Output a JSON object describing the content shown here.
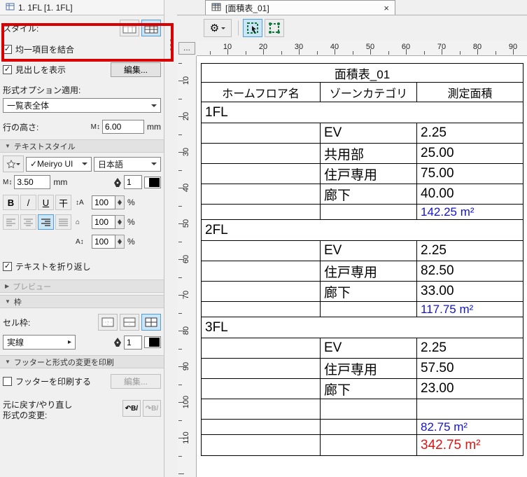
{
  "icons": {
    "check": "✓",
    "close": "×",
    "ellipsis": "...",
    "gear": "⚙",
    "tri_down": "▼",
    "tri_right": "▶",
    "flyout": "▸",
    "text_height": "M↕",
    "format_buttons": [
      "B",
      "/",
      "U",
      "干"
    ],
    "spacing_icons": [
      "↕A",
      "⌂",
      "A↕"
    ],
    "undo_format": "↶B/",
    "redo_format": "↷B/"
  },
  "colors": {
    "annotation_red": "#d80000",
    "sum_text_blue": "#1414cc",
    "total_text_red": "#e01414",
    "selected_button_blue": "#cde6f7",
    "marquee_green": "#0c7a3c"
  },
  "sidebar": {
    "tab_label": "1. 1FL [1. 1FL]",
    "style_label": "スタイル:",
    "merge_uniform_label": "均一項目を結合",
    "show_heading_label": "見出しを表示",
    "edit_button": "編集...",
    "apply_format_label": "形式オプション適用:",
    "scheme_scope_value": "一覧表全体",
    "row_height_label": "行の高さ:",
    "units_mm": "mm",
    "percent": "%",
    "text_style_header": "テキストスタイル",
    "font_name": "✓Meiryo UI",
    "language_value": "日本語",
    "wrap_label": "テキストを折り返し",
    "preview_header": "プレビュー",
    "frame_header": "枠",
    "cell_border_label": "セル枠:",
    "line_type_value": "実線",
    "footer_header": "フッターと形式の変更を印刷",
    "print_footer_label": "フッターを印刷する",
    "edit_button2": "編集...",
    "undo_line1": "元に戻す/やり直し",
    "undo_line2": "形式の変更:",
    "values": {
      "row_height": "6.00",
      "font_size": "3.50",
      "pen_text": "1",
      "pen_frame": "1",
      "spacing": [
        "100",
        "100",
        "100"
      ]
    }
  },
  "main": {
    "tab_label": "[面積表_01]"
  },
  "rulers": {
    "horizontal": [
      10,
      20,
      30,
      40,
      50,
      60,
      70,
      80,
      90
    ],
    "vertical": [
      10,
      20,
      30,
      40,
      50,
      60,
      70,
      80,
      90,
      100,
      110
    ]
  },
  "table": {
    "title": "面積表_01",
    "headers": [
      "ホームフロア名",
      "ゾーンカテゴリ",
      "測定面積"
    ],
    "rows": [
      {
        "type": "floor",
        "label": "1FL"
      },
      {
        "type": "zone",
        "category": "EV",
        "area": "2.25"
      },
      {
        "type": "zone",
        "category": "共用部",
        "area": "25.00"
      },
      {
        "type": "zone",
        "category": "住戸専用",
        "area": "75.00"
      },
      {
        "type": "zone",
        "category": "廊下",
        "area": "40.00"
      },
      {
        "type": "sum",
        "value": "142.25 m²"
      },
      {
        "type": "floor",
        "label": "2FL"
      },
      {
        "type": "zone",
        "category": "EV",
        "area": "2.25"
      },
      {
        "type": "zone",
        "category": "住戸専用",
        "area": "82.50"
      },
      {
        "type": "zone",
        "category": "廊下",
        "area": "33.00"
      },
      {
        "type": "sum",
        "value": "117.75 m²"
      },
      {
        "type": "floor",
        "label": "3FL"
      },
      {
        "type": "zone",
        "category": "EV",
        "area": "2.25"
      },
      {
        "type": "zone",
        "category": "住戸専用",
        "area": "57.50"
      },
      {
        "type": "zone",
        "category": "廊下",
        "area": "23.00"
      },
      {
        "type": "empty"
      },
      {
        "type": "sum",
        "value": "82.75 m²"
      },
      {
        "type": "total",
        "value": "342.75 m²"
      }
    ]
  }
}
